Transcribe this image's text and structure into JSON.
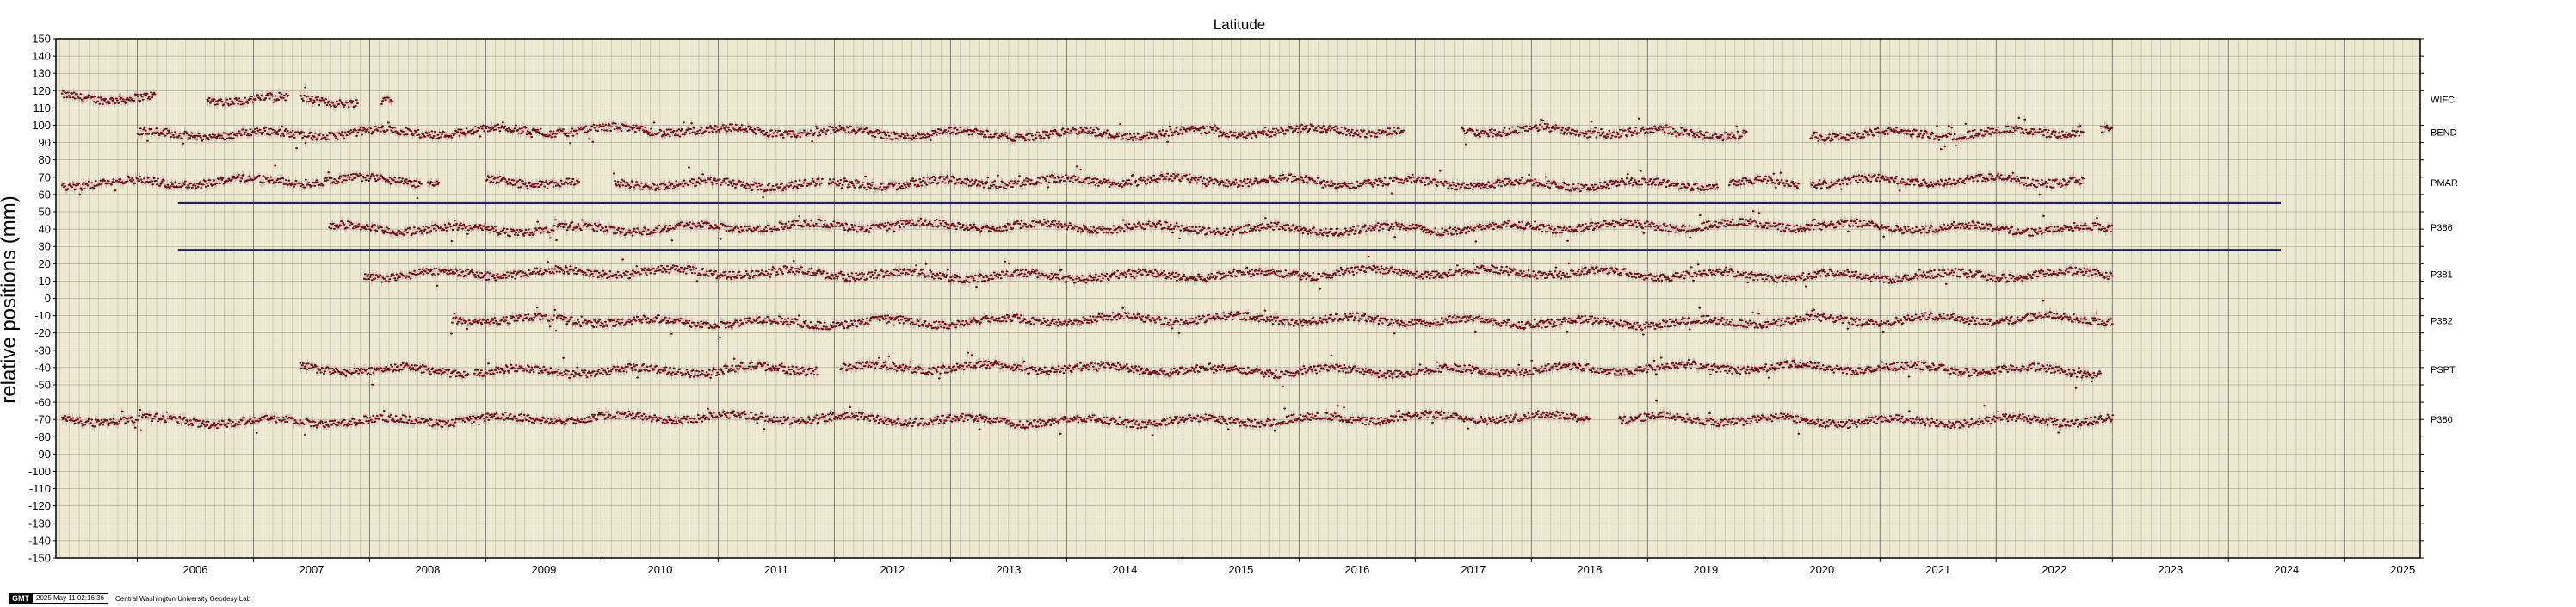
{
  "chart_data": {
    "type": "scatter",
    "title": "Latitude",
    "ylabel": "relative positions (mm)",
    "xlabel": "",
    "xlim": [
      2005.3,
      2025.65
    ],
    "ylim": [
      -150,
      150
    ],
    "grid": true,
    "x_ticks": [
      "2006",
      "2007",
      "2008",
      "2009",
      "2010",
      "2011",
      "2012",
      "2013",
      "2014",
      "2015",
      "2016",
      "2017",
      "2018",
      "2019",
      "2020",
      "2021",
      "2022",
      "2023",
      "2024",
      "2025"
    ],
    "y_ticks": [
      "150",
      "140",
      "130",
      "120",
      "110",
      "100",
      "90",
      "80",
      "70",
      "60",
      "50",
      "40",
      "30",
      "20",
      "10",
      "0",
      "-10",
      "-20",
      "-30",
      "-40",
      "-50",
      "-60",
      "-70",
      "-80",
      "-90",
      "-100",
      "-110",
      "-120",
      "-130",
      "-140",
      "-150"
    ],
    "colors": {
      "background": "#ede8d0",
      "points": "#7a0d10",
      "error_bars": "#bdbdbd",
      "reference_lines": "#1a1a8c",
      "grid": "#555555"
    },
    "series": [
      {
        "name": "WIFC",
        "offset": 115,
        "segments": [
          [
            2005.35,
            2006.15
          ],
          [
            2006.6,
            2007.3
          ],
          [
            2007.4,
            2007.9
          ],
          [
            2008.1,
            2008.2
          ]
        ]
      },
      {
        "name": "BEND",
        "offset": 96,
        "segments": [
          [
            2006.0,
            2016.9
          ],
          [
            2017.4,
            2019.85
          ],
          [
            2020.4,
            2022.75
          ],
          [
            2022.9,
            2023.0
          ]
        ]
      },
      {
        "name": "PMAR",
        "offset": 67,
        "segments": [
          [
            2005.35,
            2006.3
          ],
          [
            2006.3,
            2008.45
          ],
          [
            2008.5,
            2008.6
          ],
          [
            2009.0,
            2009.8
          ],
          [
            2010.1,
            2011.9
          ],
          [
            2011.95,
            2019.6
          ],
          [
            2019.7,
            2020.3
          ],
          [
            2020.4,
            2022.75
          ]
        ]
      },
      {
        "name": "P386",
        "offset": 41,
        "segments": [
          [
            2007.65,
            2023.0
          ]
        ]
      },
      {
        "name": "P381",
        "offset": 14,
        "segments": [
          [
            2007.95,
            2023.0
          ]
        ]
      },
      {
        "name": "P382",
        "offset": -13,
        "segments": [
          [
            2008.7,
            2023.0
          ]
        ]
      },
      {
        "name": "PSPT",
        "offset": -41,
        "segments": [
          [
            2007.4,
            2008.85
          ],
          [
            2008.9,
            2011.85
          ],
          [
            2012.05,
            2022.9
          ]
        ]
      },
      {
        "name": "P380",
        "offset": -70,
        "segments": [
          [
            2005.35,
            2016.5
          ],
          [
            2016.5,
            2018.5
          ],
          [
            2018.75,
            2023.0
          ]
        ]
      }
    ],
    "reference_lines": [
      {
        "y": 55,
        "x": [
          2006.35,
          2024.45
        ]
      },
      {
        "y": 28,
        "x": [
          2006.35,
          2024.45
        ]
      }
    ]
  },
  "footer": {
    "badge": "GMT",
    "timestamp": "2025 May 11 02:16:36",
    "lab": "Central Washington University Geodesy Lab"
  }
}
